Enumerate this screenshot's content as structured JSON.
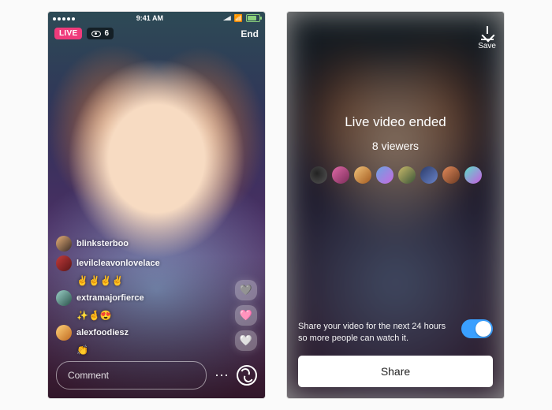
{
  "left": {
    "status": {
      "time": "9:41 AM",
      "carrier_dots": 5
    },
    "live_badge": "LIVE",
    "viewer_count": "6",
    "end_button": "End",
    "comments": [
      {
        "username": "blinksterboo",
        "reaction": ""
      },
      {
        "username": "levilcleavonlovelace",
        "reaction": "✌️✌️✌️✌️"
      },
      {
        "username": "extramajorfierce",
        "reaction": "✨🤞😍"
      },
      {
        "username": "alexfoodiesz",
        "reaction": "👏"
      }
    ],
    "comment_placeholder": "Comment",
    "reaction_hearts": [
      "🩶",
      "🩷",
      "🤍"
    ]
  },
  "right": {
    "save_label": "Save",
    "ended_title": "Live video ended",
    "viewers_line": "8 viewers",
    "viewer_avatars": 8,
    "share_hint": "Share your video for the next 24 hours so more people can watch it.",
    "share_toggle_on": true,
    "share_button": "Share"
  }
}
